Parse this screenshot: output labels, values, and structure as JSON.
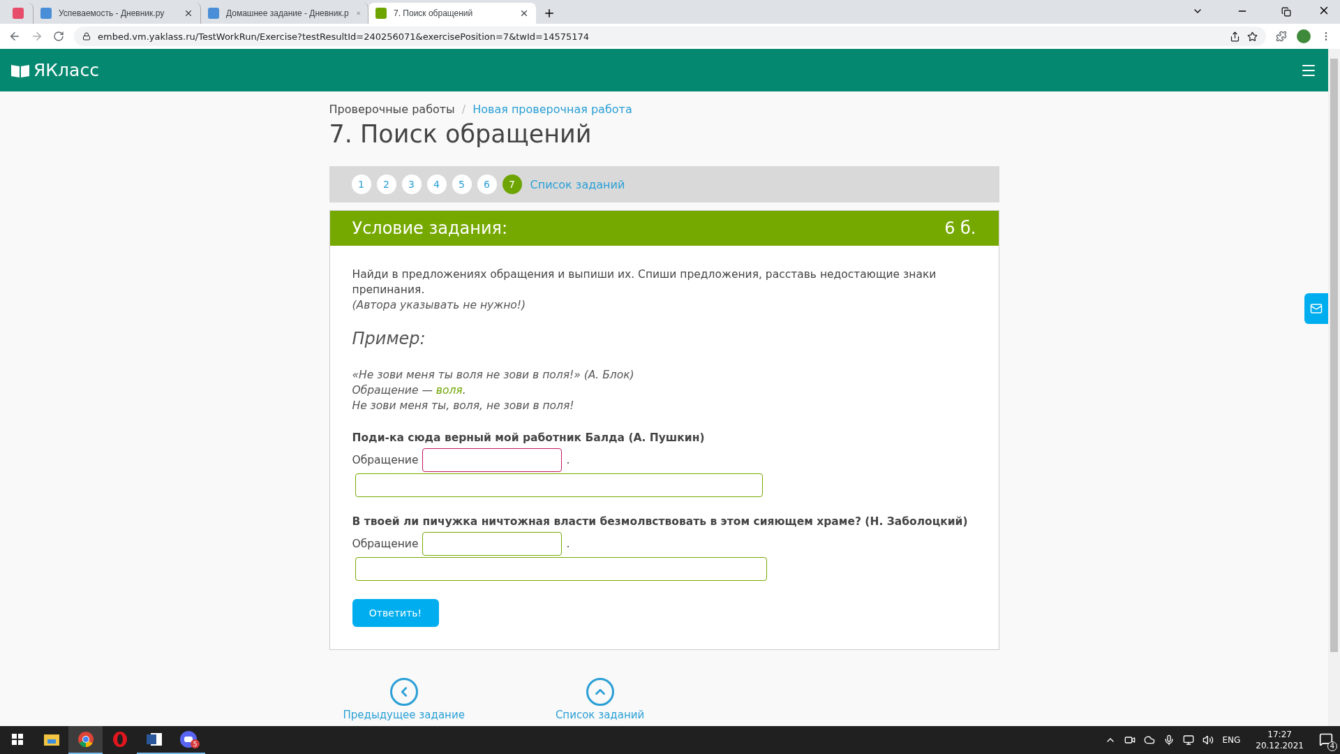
{
  "browser": {
    "tabs": [
      {
        "kind": "pinned",
        "selected": false
      },
      {
        "kind": "page",
        "title": "Успеваемость - Дневник.ру",
        "selected": false
      },
      {
        "kind": "page",
        "title": "Домашнее задание - Дневник.р",
        "selected": false
      },
      {
        "kind": "page",
        "title": "7. Поиск обращений",
        "selected": true
      }
    ],
    "address": "embed.vm.yaklass.ru/TestWorkRun/Exercise?testResultId=240256071&exercisePosition=7&twId=14575174"
  },
  "site": {
    "logo": "ЯКласс"
  },
  "breadcrumb_separator": "/",
  "breadcrumbs": [
    {
      "label": "Проверочные работы",
      "link": false
    },
    {
      "label": "Новая проверочная работа",
      "link": true
    }
  ],
  "title": "7. Поиск обращений",
  "task_nav": {
    "items": [
      {
        "label": "1",
        "selected": false
      },
      {
        "label": "2",
        "selected": false
      },
      {
        "label": "3",
        "selected": false
      },
      {
        "label": "4",
        "selected": false
      },
      {
        "label": "5",
        "selected": false
      },
      {
        "label": "6",
        "selected": false
      },
      {
        "label": "7",
        "selected": true
      }
    ],
    "list_link": "Список заданий"
  },
  "task": {
    "heading": "Условие задания:",
    "points": "6 б.",
    "instructions": "Найди в предложениях обращения и выпиши их. Спиши предложения, расставь недостающие знаки препинания.",
    "note": "(Автора указывать не нужно!)",
    "example_heading": "Пример:",
    "example_source": "«Не зови меня ты воля не зови в поля!» (А. Блок)",
    "example_answer": {
      "label": "Обращение —",
      "word": "воля",
      "end": "."
    },
    "example_result": "Не зови меня ты, воля, не зови в поля!",
    "questions": [
      {
        "sentence": "Поди-ка сюда верный мой работник Балда (А. Пушкин)",
        "label": "Обращение",
        "after": ".",
        "focused": true
      },
      {
        "sentence": "В твоей ли пичужка ничтожная власти безмолвствовать в этом сияющем храме? (Н. Заболоцкий)",
        "label": "Обращение",
        "after": ".",
        "focused": false
      }
    ],
    "submit": "Ответить!"
  },
  "bottom_nav": [
    {
      "kind": "prev",
      "label": "Предыдущее задание"
    },
    {
      "kind": "up",
      "label": "Список заданий"
    }
  ],
  "taskbar": {
    "apps": [
      {
        "kind": "explorer",
        "active": false,
        "running": false
      },
      {
        "kind": "chrome",
        "active": true,
        "running": true
      },
      {
        "kind": "opera",
        "active": false,
        "running": false
      },
      {
        "kind": "word",
        "active": false,
        "running": true
      },
      {
        "kind": "discord",
        "active": false,
        "running": true,
        "badge": "5"
      }
    ],
    "language": "ENG",
    "time": "17:27",
    "date": "20.12.2021",
    "notifications": "4"
  }
}
